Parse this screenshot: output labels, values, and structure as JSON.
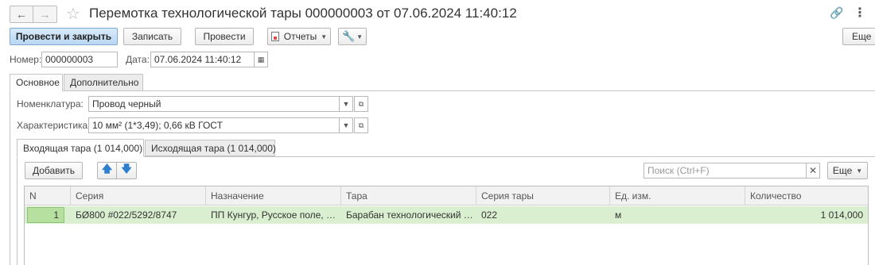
{
  "window": {
    "title": "Перемотка технологической тары 000000003 от 07.06.2024 11:40:12",
    "back_icon": "arrow-left-icon",
    "forward_icon": "arrow-right-icon"
  },
  "toolbar": {
    "post_close_label": "Провести и закрыть",
    "save_label": "Записать",
    "post_label": "Провести",
    "reports_label": "Отчеты",
    "more_label": "Еще"
  },
  "header": {
    "number_label": "Номер:",
    "number_value": "000000003",
    "date_label": "Дата:",
    "date_value": "07.06.2024 11:40:12"
  },
  "tabs": [
    {
      "label": "Основное",
      "active": true
    },
    {
      "label": "Дополнительно",
      "active": false
    }
  ],
  "fields": {
    "nomenclature_label": "Номенклатура:",
    "nomenclature_value": "Провод черный",
    "characteristic_label": "Характеристика:",
    "characteristic_value": "10 мм² (1*3,49); 0,66 кВ ГОСТ"
  },
  "subtabs": [
    {
      "label": "Входящая тара (1 014,000)",
      "active": true
    },
    {
      "label": "Исходящая тара (1 014,000)",
      "active": false
    }
  ],
  "table_toolbar": {
    "add_label": "Добавить",
    "search_placeholder": "Поиск (Ctrl+F)",
    "more_label": "Еще"
  },
  "table": {
    "columns": [
      "N",
      "Серия",
      "Назначение",
      "Тара",
      "Серия тары",
      "Ед. изм.",
      "Количество"
    ],
    "rows": [
      {
        "n": "1",
        "series": "БØ800 #022/5292/8747",
        "purpose": "ПП Кунгур, Русское поле, …",
        "container": "Барабан технологический …",
        "container_series": "022",
        "unit": "м",
        "quantity": "1 014,000"
      }
    ]
  },
  "colors": {
    "primary_button": "#c6def6",
    "selected_row": "#d9efcf",
    "selected_cell": "#b5e0a0"
  }
}
